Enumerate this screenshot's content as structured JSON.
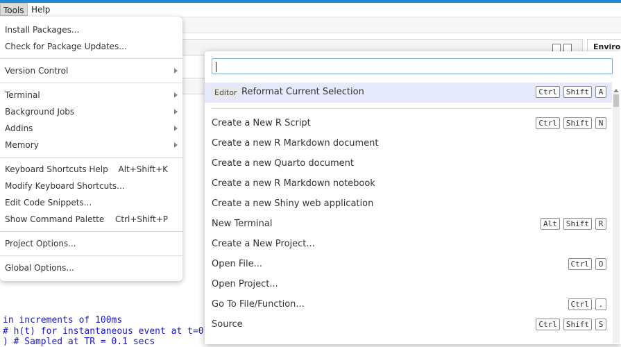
{
  "menubar": {
    "items": [
      {
        "label": "Tools",
        "active": true
      },
      {
        "label": "Help",
        "active": false
      }
    ]
  },
  "background": {
    "environment_tab": "Environ",
    "code_lines": [
      "in increments of 100ms",
      "# h(t) for instantaneous event at t=0",
      ") # Sampled at TR = 0.1 secs"
    ]
  },
  "tools_menu": {
    "items": [
      {
        "label": "Install Packages...",
        "shortcut": "",
        "submenu": false
      },
      {
        "label": "Check for Package Updates...",
        "shortcut": "",
        "submenu": false
      },
      {
        "label": "Version Control",
        "shortcut": "",
        "submenu": true
      },
      {
        "label": "Terminal",
        "shortcut": "",
        "submenu": true
      },
      {
        "label": "Background Jobs",
        "shortcut": "",
        "submenu": true
      },
      {
        "label": "Addins",
        "shortcut": "",
        "submenu": true
      },
      {
        "label": "Memory",
        "shortcut": "",
        "submenu": true
      },
      {
        "label": "Keyboard Shortcuts Help",
        "shortcut": "Alt+Shift+K",
        "submenu": false
      },
      {
        "label": "Modify Keyboard Shortcuts...",
        "shortcut": "",
        "submenu": false
      },
      {
        "label": "Edit Code Snippets...",
        "shortcut": "",
        "submenu": false
      },
      {
        "label": "Show Command Palette",
        "shortcut": "Ctrl+Shift+P",
        "submenu": false
      },
      {
        "label": "Project Options...",
        "shortcut": "",
        "submenu": false
      },
      {
        "label": "Global Options...",
        "shortcut": "",
        "submenu": false
      }
    ]
  },
  "palette": {
    "search_value": "",
    "selected": {
      "context": "Editor",
      "label": "Reformat Current Selection",
      "keys": [
        "Ctrl",
        "Shift",
        "A"
      ]
    },
    "items": [
      {
        "label": "Create a New R Script",
        "keys": [
          "Ctrl",
          "Shift",
          "N"
        ]
      },
      {
        "label": "Create a new R Markdown document",
        "keys": []
      },
      {
        "label": "Create a new Quarto document",
        "keys": []
      },
      {
        "label": "Create a new R Markdown notebook",
        "keys": []
      },
      {
        "label": "Create a new Shiny web application",
        "keys": []
      },
      {
        "label": "New Terminal",
        "keys": [
          "Alt",
          "Shift",
          "R"
        ]
      },
      {
        "label": "Create a New Project...",
        "keys": []
      },
      {
        "label": "Open File...",
        "keys": [
          "Ctrl",
          "O"
        ]
      },
      {
        "label": "Open Project...",
        "keys": []
      },
      {
        "label": "Go To File/Function...",
        "keys": [
          "Ctrl",
          "."
        ]
      },
      {
        "label": "Source",
        "keys": [
          "Ctrl",
          "Shift",
          "S"
        ]
      }
    ]
  }
}
